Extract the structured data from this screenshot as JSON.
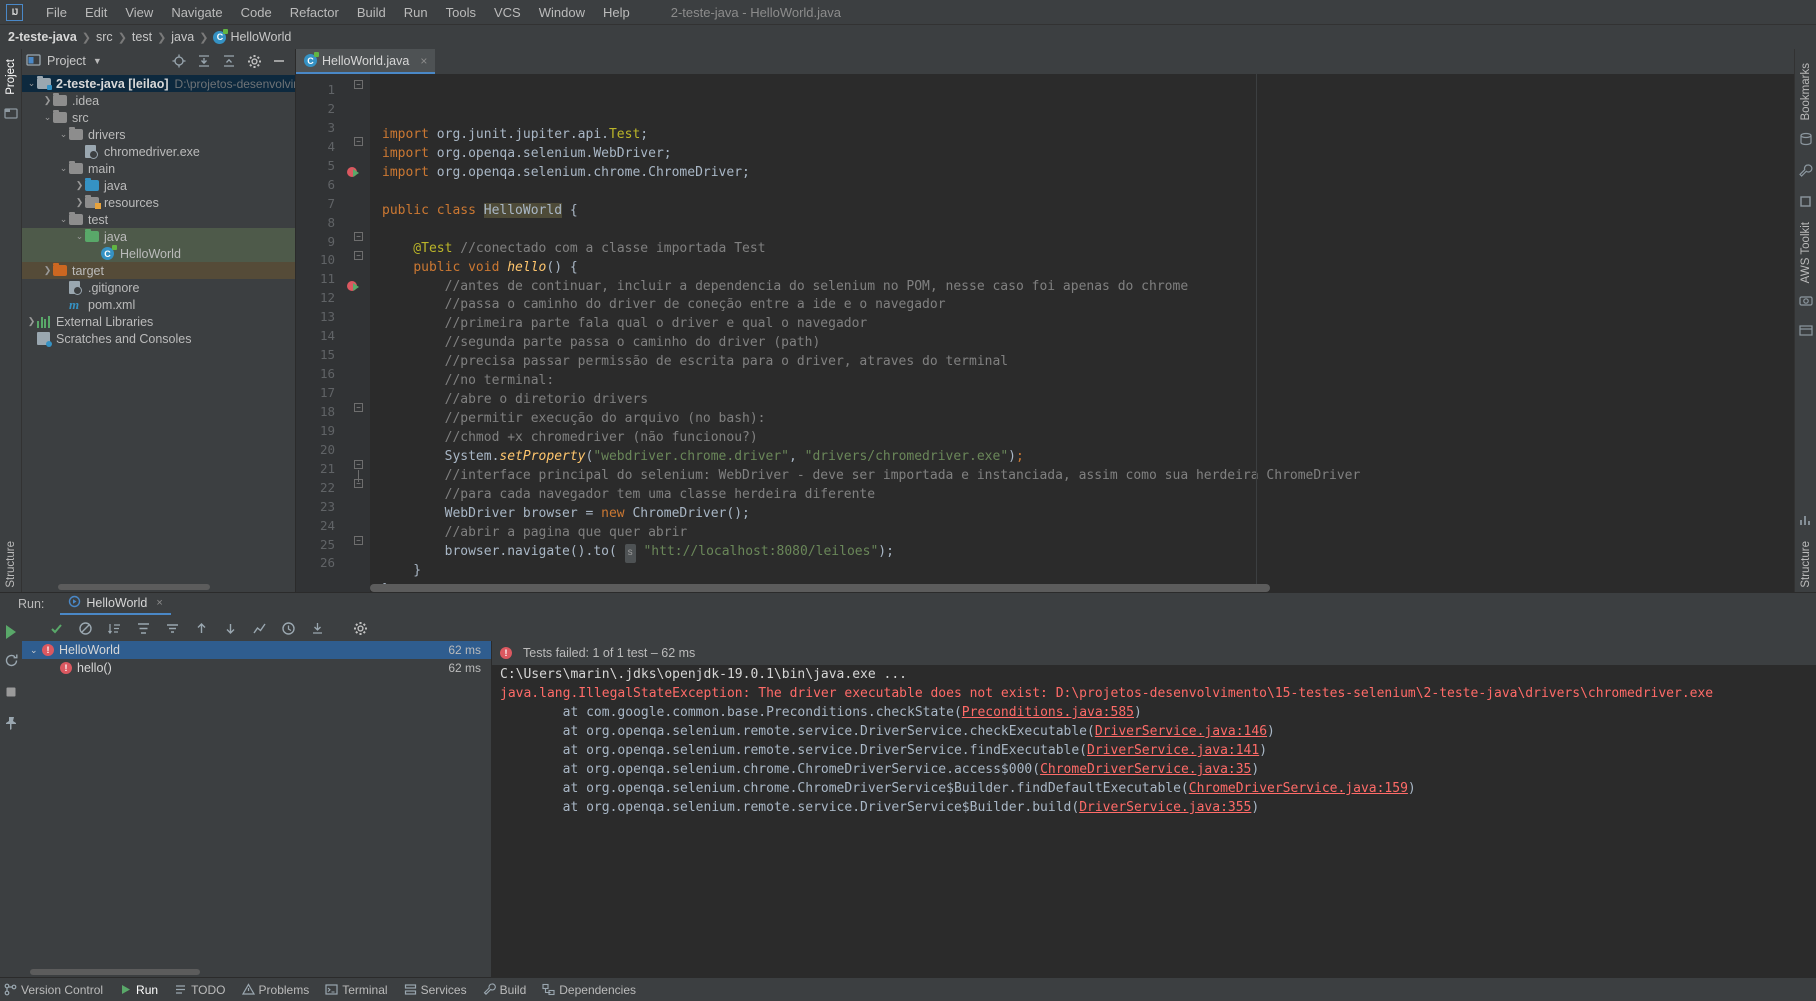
{
  "app": {
    "window_title": "2-teste-java - HelloWorld.java",
    "logo": "IJ"
  },
  "menubar": {
    "items": [
      {
        "label": "File"
      },
      {
        "label": "Edit"
      },
      {
        "label": "View"
      },
      {
        "label": "Navigate"
      },
      {
        "label": "Code"
      },
      {
        "label": "Refactor"
      },
      {
        "label": "Build"
      },
      {
        "label": "Run"
      },
      {
        "label": "Tools"
      },
      {
        "label": "VCS"
      },
      {
        "label": "Window"
      },
      {
        "label": "Help"
      }
    ]
  },
  "breadcrumb": {
    "segments": [
      "2-teste-java",
      "src",
      "test",
      "java"
    ],
    "leaf": "HelloWorld"
  },
  "left_strip": {
    "project_label": "Project",
    "structure_label": "Structure"
  },
  "project_panel": {
    "title": "Project",
    "tree": [
      {
        "label": "2-teste-java [leilao]",
        "path": "D:\\projetos-desenvolvimento",
        "indent": 0,
        "arrow": "v",
        "icon": "module-folder",
        "state": "sel-blue",
        "bold": true
      },
      {
        "label": ".idea",
        "indent": 1,
        "arrow": ">",
        "icon": "folder-gray"
      },
      {
        "label": "src",
        "indent": 1,
        "arrow": "v",
        "icon": "folder-gray"
      },
      {
        "label": "drivers",
        "indent": 2,
        "arrow": "v",
        "icon": "folder-gray"
      },
      {
        "label": "chromedriver.exe",
        "indent": 3,
        "arrow": "",
        "icon": "file-generic"
      },
      {
        "label": "main",
        "indent": 2,
        "arrow": "v",
        "icon": "folder-gray"
      },
      {
        "label": "java",
        "indent": 3,
        "arrow": ">",
        "icon": "folder-blue"
      },
      {
        "label": "resources",
        "indent": 3,
        "arrow": ">",
        "icon": "folder-resources"
      },
      {
        "label": "test",
        "indent": 2,
        "arrow": "v",
        "icon": "folder-gray"
      },
      {
        "label": "java",
        "indent": 3,
        "arrow": "v",
        "icon": "folder-green",
        "state": "sel-green"
      },
      {
        "label": "HelloWorld",
        "indent": 4,
        "arrow": "",
        "icon": "class-icon",
        "state": "sel-green"
      },
      {
        "label": "target",
        "indent": 1,
        "arrow": ">",
        "icon": "folder-orange",
        "state": "sel-brown"
      },
      {
        "label": ".gitignore",
        "indent": 2,
        "arrow": "",
        "icon": "file-generic"
      },
      {
        "label": "pom.xml",
        "indent": 2,
        "arrow": "",
        "icon": "maven-icon"
      },
      {
        "label": "External Libraries",
        "indent": 0,
        "arrow": ">",
        "icon": "library-icon"
      },
      {
        "label": "Scratches and Consoles",
        "indent": 0,
        "arrow": "",
        "icon": "scratch-icon"
      }
    ],
    "toolbar_icons": [
      "locate-icon",
      "expand-all-icon",
      "collapse-all-icon",
      "gear-icon",
      "hide-icon"
    ]
  },
  "editor": {
    "tab": {
      "label": "HelloWorld.java",
      "icon": "java-class-icon",
      "close": "×"
    },
    "lines": [
      {
        "n": 1,
        "tokens": [
          {
            "t": "import ",
            "c": "kw"
          },
          {
            "t": "org.junit.jupiter.api.",
            "c": "plain"
          },
          {
            "t": "Test",
            "c": "ann"
          },
          {
            "t": ";",
            "c": "plain"
          }
        ]
      },
      {
        "n": 2,
        "tokens": [
          {
            "t": "import ",
            "c": "kw"
          },
          {
            "t": "org.openqa.selenium.WebDriver;",
            "c": "plain"
          }
        ]
      },
      {
        "n": 3,
        "tokens": [
          {
            "t": "import ",
            "c": "kw"
          },
          {
            "t": "org.openqa.selenium.chrome.ChromeDriver;",
            "c": "plain"
          }
        ]
      },
      {
        "n": 4,
        "tokens": []
      },
      {
        "n": 5,
        "tokens": [
          {
            "t": "public class ",
            "c": "kw"
          },
          {
            "t": "HelloWorld",
            "c": "cls hl"
          },
          {
            "t": " {",
            "c": "plain"
          }
        ]
      },
      {
        "n": 6,
        "tokens": []
      },
      {
        "n": 7,
        "tokens": [
          {
            "t": "    @Test ",
            "c": "ann"
          },
          {
            "t": "//conectado com a classe importada Test",
            "c": "cmt"
          }
        ]
      },
      {
        "n": 8,
        "tokens": [
          {
            "t": "    ",
            "c": "plain"
          },
          {
            "t": "public void ",
            "c": "kw"
          },
          {
            "t": "hello",
            "c": "fn"
          },
          {
            "t": "() {",
            "c": "plain"
          }
        ]
      },
      {
        "n": 9,
        "tokens": [
          {
            "t": "        //antes de continuar, incluir a dependencia do selenium no POM, nesse caso foi apenas do chrome",
            "c": "cmt"
          }
        ]
      },
      {
        "n": 10,
        "tokens": [
          {
            "t": "        //passa o caminho do driver de coneção entre a ide e o navegador",
            "c": "cmt"
          }
        ]
      },
      {
        "n": 11,
        "tokens": [
          {
            "t": "        //primeira parte fala qual o driver e qual o navegador",
            "c": "cmt"
          }
        ]
      },
      {
        "n": 12,
        "tokens": [
          {
            "t": "        //segunda parte passa o caminho do driver (path)",
            "c": "cmt"
          }
        ]
      },
      {
        "n": 13,
        "tokens": [
          {
            "t": "        //precisa passar permissão de escrita para o driver, atraves do terminal",
            "c": "cmt"
          }
        ]
      },
      {
        "n": 14,
        "tokens": [
          {
            "t": "        //no terminal:",
            "c": "cmt"
          }
        ]
      },
      {
        "n": 15,
        "tokens": [
          {
            "t": "        //abre o diretorio drivers",
            "c": "cmt"
          }
        ]
      },
      {
        "n": 16,
        "tokens": [
          {
            "t": "        //permitir execução do arquivo (no bash):",
            "c": "cmt"
          }
        ]
      },
      {
        "n": 17,
        "tokens": [
          {
            "t": "        //chmod +x chromedriver (não funcionou?)",
            "c": "cmt"
          }
        ]
      },
      {
        "n": 18,
        "tokens": [
          {
            "t": "        System.",
            "c": "plain"
          },
          {
            "t": "setProperty",
            "c": "fn"
          },
          {
            "t": "(",
            "c": "plain"
          },
          {
            "t": "\"webdriver.chrome.driver\"",
            "c": "str"
          },
          {
            "t": ", ",
            "c": "plain"
          },
          {
            "t": "\"drivers/chromedriver.exe\"",
            "c": "str"
          },
          {
            "t": ")",
            "c": "plain"
          },
          {
            "t": ";",
            "c": "kw"
          }
        ]
      },
      {
        "n": 19,
        "tokens": [
          {
            "t": "        //interface principal do selenium: WebDriver - deve ser importada e instanciada, assim como sua herdeira ChromeDriver",
            "c": "cmt"
          }
        ]
      },
      {
        "n": 20,
        "tokens": [
          {
            "t": "        //para cada navegador tem uma classe herdeira diferente",
            "c": "cmt"
          }
        ]
      },
      {
        "n": 21,
        "tokens": [
          {
            "t": "        WebDriver browser = ",
            "c": "plain"
          },
          {
            "t": "new ",
            "c": "kw"
          },
          {
            "t": "ChromeDriver();",
            "c": "plain"
          }
        ]
      },
      {
        "n": 22,
        "tokens": [
          {
            "t": "        //abrir a pagina que quer abrir",
            "c": "cmt"
          }
        ]
      },
      {
        "n": 23,
        "tokens": [
          {
            "t": "        browser.navigate().to( ",
            "c": "plain"
          },
          {
            "t": "s",
            "c": "hint"
          },
          {
            "t": " ",
            "c": "plain"
          },
          {
            "t": "\"htt://localhost:8080/leiloes\"",
            "c": "str"
          },
          {
            "t": ");",
            "c": "plain"
          }
        ]
      },
      {
        "n": 24,
        "tokens": [
          {
            "t": "    }",
            "c": "plain"
          }
        ]
      },
      {
        "n": 25,
        "tokens": [
          {
            "t": "}",
            "c": "plain"
          }
        ]
      },
      {
        "n": 26,
        "tokens": []
      }
    ]
  },
  "run_panel": {
    "label": "Run:",
    "tab_label": "HelloWorld",
    "tab_close": "×",
    "toolbar_icons": [
      "rerun-icon",
      "ok-filter-icon",
      "ignore-icon",
      "sort-icon",
      "sort-duration-icon",
      "expand-icon",
      "collapse-icon",
      "prev-icon",
      "next-icon",
      "chart-icon",
      "history-icon",
      "export-icon",
      "settings-icon"
    ],
    "left_toolbar_icons": [
      "run-icon",
      "rerun-failed-icon",
      "stop-icon",
      "pin-icon"
    ],
    "tests": [
      {
        "label": "HelloWorld",
        "time": "62 ms",
        "selected": true,
        "arrow": "v",
        "status": "failed"
      },
      {
        "label": "hello()",
        "time": "62 ms",
        "selected": false,
        "arrow": "",
        "status": "failed",
        "indent": 1
      }
    ],
    "status_text": "Tests failed: 1 of 1 test – 62 ms",
    "console": [
      {
        "text": "C:\\Users\\marin\\.jdks\\openjdk-19.0.1\\bin\\java.exe ...",
        "style": "white"
      },
      {
        "text": "",
        "style": "plain"
      },
      {
        "text": "java.lang.IllegalStateException: The driver executable does not exist: D:\\projetos-desenvolvimento\\15-testes-selenium\\2-teste-java\\drivers\\chromedriver.exe",
        "style": "err"
      },
      {
        "text": "",
        "style": "plain"
      },
      {
        "text": "\tat com.google.common.base.Preconditions.checkState(",
        "link": "Preconditions.java:585",
        "tail": ")",
        "style": "gray"
      },
      {
        "text": "\tat org.openqa.selenium.remote.service.DriverService.checkExecutable(",
        "link": "DriverService.java:146",
        "tail": ")",
        "style": "gray"
      },
      {
        "text": "\tat org.openqa.selenium.remote.service.DriverService.findExecutable(",
        "link": "DriverService.java:141",
        "tail": ")",
        "style": "gray"
      },
      {
        "text": "\tat org.openqa.selenium.chrome.ChromeDriverService.access$000(",
        "link": "ChromeDriverService.java:35",
        "tail": ")",
        "style": "gray"
      },
      {
        "text": "\tat org.openqa.selenium.chrome.ChromeDriverService$Builder.findDefaultExecutable(",
        "link": "ChromeDriverService.java:159",
        "tail": ")",
        "style": "gray"
      },
      {
        "text": "\tat org.openqa.selenium.remote.service.DriverService$Builder.build(",
        "link": "DriverService.java:355",
        "tail": ")",
        "style": "gray"
      }
    ]
  },
  "right_strip": {
    "items": [
      "Bookmarks",
      "AWS Toolkit",
      "Structure"
    ]
  },
  "statusbar": {
    "items": [
      {
        "label": "Version Control",
        "icon": "branch-icon",
        "active": false
      },
      {
        "label": "Run",
        "icon": "play-icon",
        "active": true
      },
      {
        "label": "TODO",
        "icon": "todo-icon",
        "active": false
      },
      {
        "label": "Problems",
        "icon": "problems-icon",
        "active": false
      },
      {
        "label": "Terminal",
        "icon": "terminal-icon",
        "active": false
      },
      {
        "label": "Services",
        "icon": "services-icon",
        "active": false
      },
      {
        "label": "Build",
        "icon": "build-icon",
        "active": false
      },
      {
        "label": "Dependencies",
        "icon": "dependencies-icon",
        "active": false
      }
    ]
  },
  "colors": {
    "bg_panel": "#3c3f41",
    "bg_editor": "#2b2b2b",
    "accent_blue": "#4a88c7",
    "error_red": "#db5860",
    "success_green": "#59a869",
    "string_green": "#6a8759",
    "keyword_orange": "#cc7832"
  }
}
